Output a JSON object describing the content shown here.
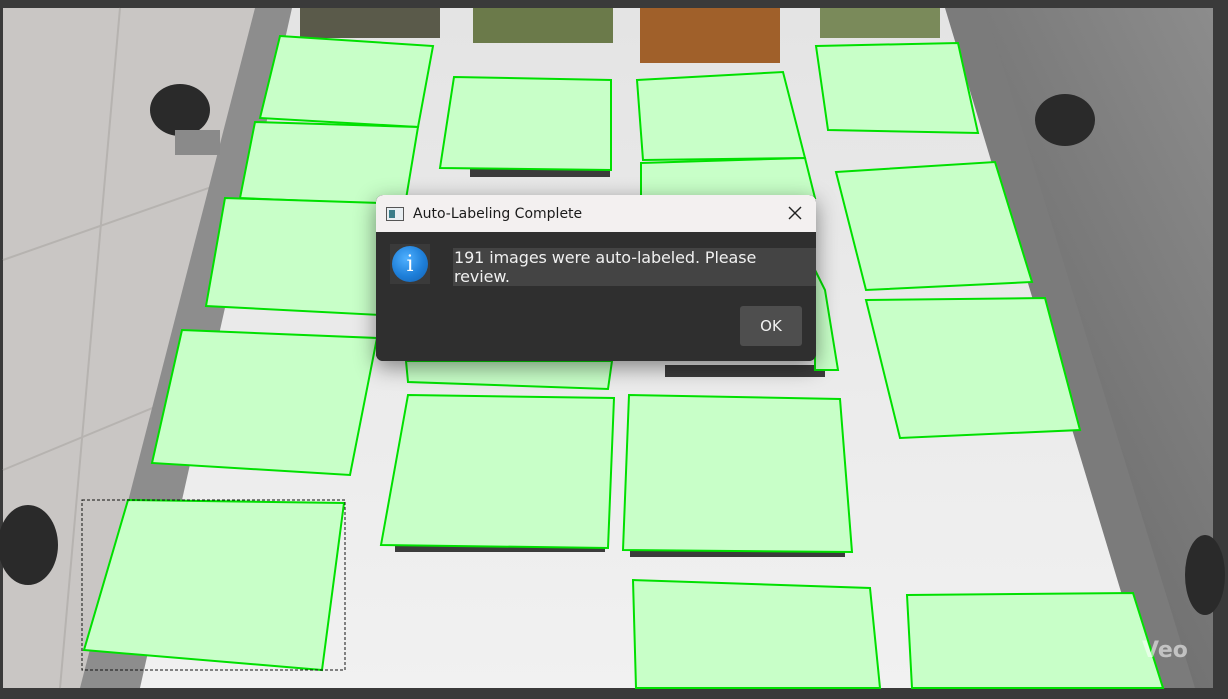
{
  "dialog": {
    "title": "Auto-Labeling Complete",
    "close_icon": "close-icon",
    "info_icon": "info-icon",
    "message": "191 images were auto-labeled. Please review.",
    "ok_label": "OK"
  },
  "canvas": {
    "description_icon": "app-window-icon",
    "box_color": "#00e000",
    "box_fill": "#c8ffc8",
    "selected_box_index": 15
  },
  "watermark": "Veo"
}
